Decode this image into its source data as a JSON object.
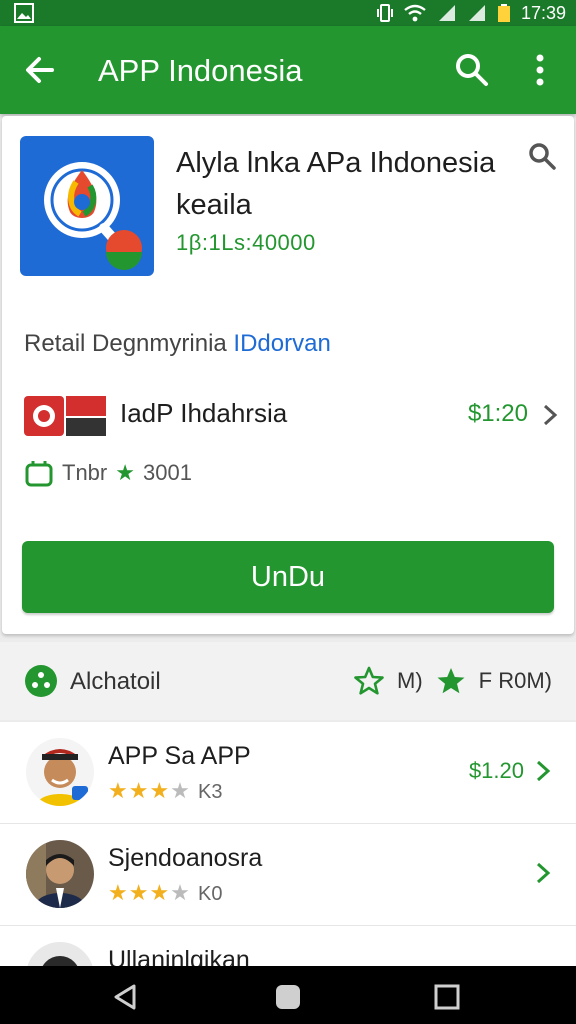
{
  "status_bar": {
    "time": "17:39"
  },
  "app_bar": {
    "title": "APP Indonesia"
  },
  "app": {
    "name": "Alyla lnka APa Ihdonesia keaila",
    "price": "1β:1Ls:40000"
  },
  "detail": {
    "text": "Retail Degnmyrinia",
    "link": "IDdorvan"
  },
  "listing": {
    "name": "IadP Ihdahrsia",
    "price": "$1:20"
  },
  "rating": {
    "label": "Tnbr",
    "count": "3001"
  },
  "download_button": {
    "label": "UnDu"
  },
  "section": {
    "label": "Alchatoil",
    "action1": "M)",
    "action2": "F R0M)"
  },
  "items": [
    {
      "title": "APP Sa APP",
      "rating_text": "K3",
      "price": "$1.20"
    },
    {
      "title": "Sjendoanosra",
      "rating_text": "K0",
      "price": ""
    },
    {
      "title": "Ullaninlgikan",
      "rating_text": "",
      "price": ""
    }
  ],
  "colors": {
    "primary": "#23962f",
    "status_bar": "#1a7a2a",
    "link": "#1f6bd6",
    "star": "#f2b01e"
  }
}
